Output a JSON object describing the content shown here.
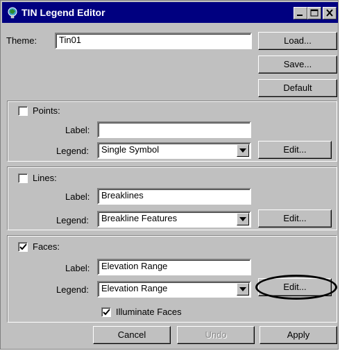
{
  "window": {
    "title": "TIN Legend Editor",
    "icon": "tin-globe-icon",
    "title_colors": {
      "bar": "#000080",
      "text": "#ffffff"
    }
  },
  "theme": {
    "label": "Theme:",
    "value": "Tin01",
    "buttons": {
      "load": "Load...",
      "save": "Save...",
      "default": "Default"
    }
  },
  "points": {
    "title": "Points:",
    "checked": false,
    "label_caption": "Label:",
    "label_value": "",
    "legend_caption": "Legend:",
    "legend_value": "Single Symbol",
    "edit_label": "Edit..."
  },
  "lines": {
    "title": "Lines:",
    "checked": false,
    "label_caption": "Label:",
    "label_value": "Breaklines",
    "legend_caption": "Legend:",
    "legend_value": "Breakline Features",
    "edit_label": "Edit..."
  },
  "faces": {
    "title": "Faces:",
    "checked": true,
    "label_caption": "Label:",
    "label_value": "Elevation Range",
    "legend_caption": "Legend:",
    "legend_value": "Elevation Range",
    "edit_label": "Edit...",
    "illuminate_label": "Illuminate Faces",
    "illuminate_checked": true
  },
  "footer": {
    "cancel": "Cancel",
    "undo": "Undo",
    "apply": "Apply"
  }
}
